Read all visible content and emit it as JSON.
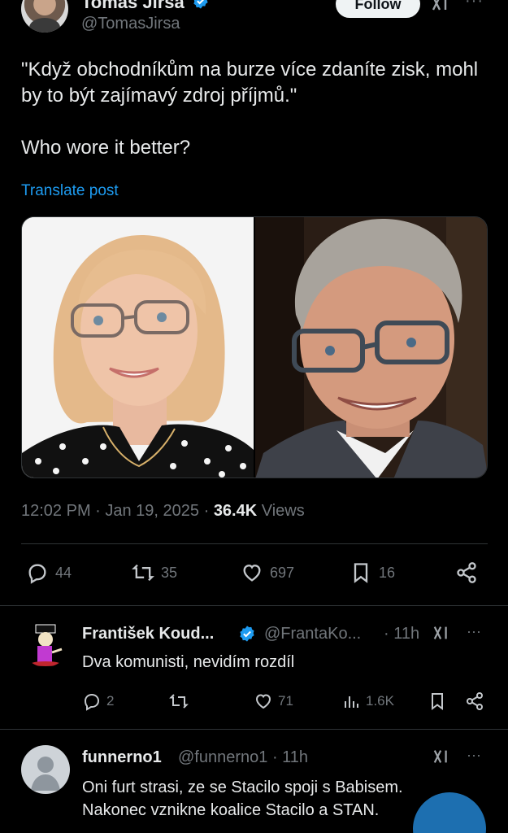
{
  "tweet": {
    "author_name": "Tomas Jirsa",
    "author_handle": "@TomasJirsa",
    "follow_label": "Follow",
    "more_label": "···",
    "text_line1": "\"Když obchodníkům na burze více zdaníte zisk, mohl by to být zajímavý zdroj příjmů.\"",
    "text_line2": "Who wore it better?",
    "translate_label": "Translate post",
    "time": "12:02 PM · Jan 19, 2025 · ",
    "views_count": "36.4K",
    "views_label": " Views",
    "actions": {
      "replies": "44",
      "reposts": "35",
      "likes": "697",
      "bookmarks": "16"
    }
  },
  "replies": [
    {
      "name": "František Koud...",
      "handle": "@FrantaKo...",
      "time": "· 11h",
      "text": "Dva komunisti, nevidím rozdíl",
      "replies": "2",
      "reposts": "",
      "likes": "71",
      "views": "1.6K"
    },
    {
      "name": "funnerno1",
      "handle": "@funnerno1 · 11h",
      "text": "Oni furt strasi, ze se Stacilo spoji s Babisem. Nakonec vznikne koalice Stacilo a STAN."
    }
  ],
  "colors": {
    "background": "#000000",
    "text": "#e7e9ea",
    "muted": "#71767b",
    "link": "#1d9bf0",
    "verified": "#1d9bf0"
  },
  "icons": [
    "verified-badge-icon",
    "grok-icon",
    "more-icon",
    "reply-icon",
    "repost-icon",
    "like-icon",
    "bookmark-icon",
    "share-icon",
    "views-icon"
  ]
}
